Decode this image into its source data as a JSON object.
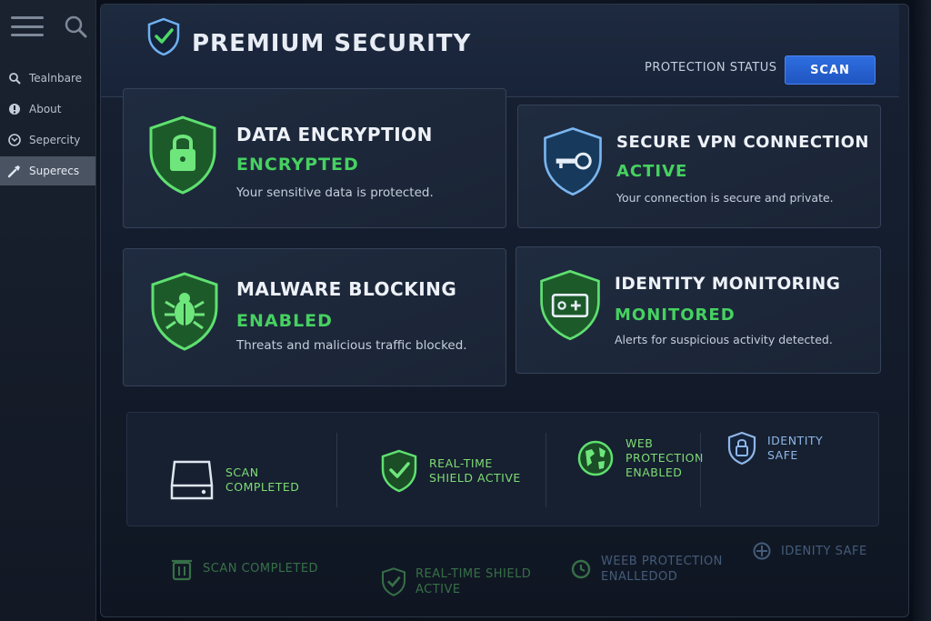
{
  "sidebar": {
    "items": [
      {
        "label": "Tealnbare",
        "icon": "search-icon"
      },
      {
        "label": "About",
        "icon": "info-icon"
      },
      {
        "label": "Sepercity",
        "icon": "mail-icon"
      },
      {
        "label": "Superecs",
        "icon": "wrench-icon",
        "active": true
      }
    ]
  },
  "header": {
    "title": "PREMIUM SECURITY",
    "status_label": "PROTECTION STATUS",
    "scan_button": "SCAN"
  },
  "cards": [
    {
      "title": "DATA ENCRYPTION",
      "status": "ENCRYPTED",
      "description": "Your sensitive data is protected.",
      "icon": "lock-icon"
    },
    {
      "title": "SECURE VPN CONNECTION",
      "status": "ACTIVE",
      "description": "Your connection is secure and private.",
      "icon": "key-icon"
    },
    {
      "title": "MALWARE BLOCKING",
      "status": "ENABLED",
      "description": "Threats and malicious traffic blocked.",
      "icon": "bug-icon"
    },
    {
      "title": "IDENTITY MONITORING",
      "status": "MONITORED",
      "description": "Alerts for suspicious activity detected.",
      "icon": "id-card-icon"
    }
  ],
  "status_strip": [
    {
      "label": "SCAN\nCOMPLETED",
      "icon": "hard-drive-icon"
    },
    {
      "label": "REAL-TIME\nSHIELD ACTIVE",
      "icon": "shield-check-icon"
    },
    {
      "label": "WEB\nPROTECTION\nENABLED",
      "icon": "globe-icon"
    },
    {
      "label": "IDENTITY\nSAFE",
      "icon": "shield-lock-icon"
    }
  ],
  "reflection": [
    {
      "label": "SCAN COMPLETED",
      "icon": "trash-icon"
    },
    {
      "label": "REAL-TIME SHIELD\nACTIVE",
      "icon": "shield-check-icon"
    },
    {
      "label": "WEEB PROTECTION\nENALLEDOD",
      "icon": "refresh-icon"
    },
    {
      "label": "IDENITY SAFE",
      "icon": "target-icon"
    }
  ],
  "colors": {
    "accent_green": "#46d160",
    "accent_blue": "#2f6ee0",
    "panel_bg": "#172133"
  }
}
